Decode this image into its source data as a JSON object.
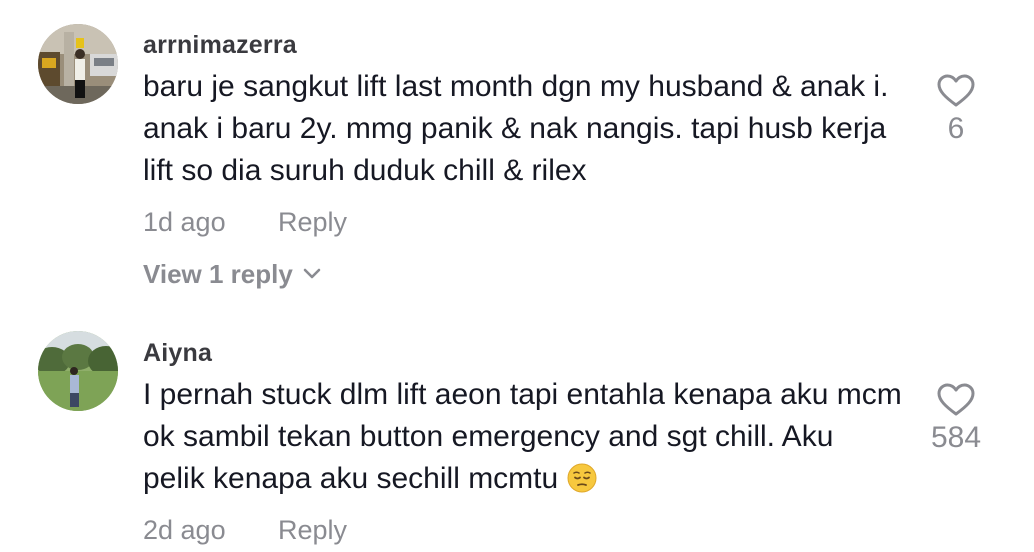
{
  "comments": [
    {
      "username": "arrnimazerra",
      "text": "baru je sangkut lift last month dgn my husband & anak i. anak i baru 2y. mmg panik & nak nangis. tapi husb kerja lift so dia suruh duduk chill & rilex",
      "time": "1d ago",
      "reply_label": "Reply",
      "view_replies": "View 1 reply",
      "likes": "6"
    },
    {
      "username": "Aiyna",
      "text": "I pernah stuck dlm lift aeon tapi entahla kenapa aku mcm ok sambil tekan button emergency and sgt chill. Aku pelik kenapa aku sechill mcmtu",
      "emoji": "pensive-face",
      "time": "2d ago",
      "reply_label": "Reply",
      "likes": "584"
    }
  ],
  "icons": {
    "like": "heart-outline-icon",
    "expand": "chevron-down-icon"
  },
  "colors": {
    "text": "#161823",
    "muted": "#8a8b91",
    "username": "#3a3a3f"
  }
}
